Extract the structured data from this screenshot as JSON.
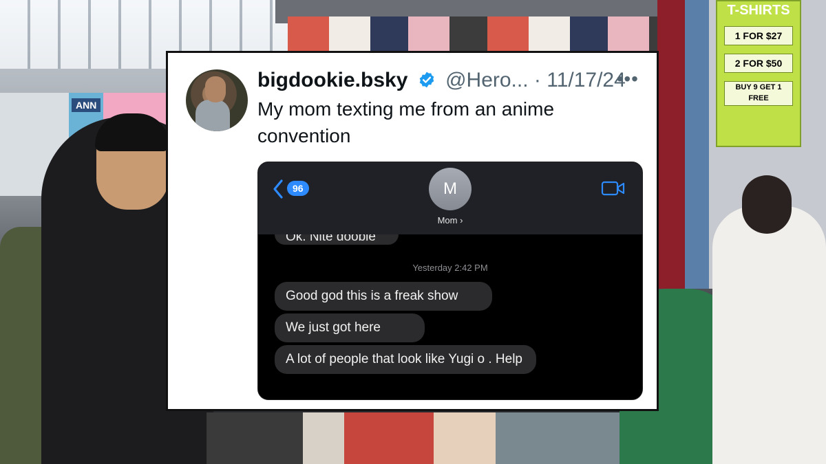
{
  "tweet": {
    "display_name": "bigdookie.bsky",
    "handle": "@Hero...",
    "separator": "·",
    "date": "11/17/24",
    "more_menu": "•••",
    "text": "My mom texting me from an anime convention",
    "avatar_icon": "profile-photo",
    "verified_icon": "verified-badge-icon",
    "verified_color": "#1d9bf0"
  },
  "imessage": {
    "back_badge": "96",
    "contact_initial": "M",
    "contact_name": "Mom ›",
    "cut_off_message": "Ok. Nite doobie",
    "timestamp": "Yesterday 2:42 PM",
    "messages": [
      "Good god this is a freak show",
      "We just got here",
      "A lot of people that look like Yugi o . Help"
    ],
    "accent_color": "#2e8bff",
    "bubble_color": "#2b2b2d"
  },
  "background": {
    "sign_title": "T-SHIRTS",
    "sign_rows": [
      "1 FOR $27",
      "2 FOR $50",
      "BUY 9 GET 1 FREE"
    ],
    "booth_sign": "ANN"
  }
}
